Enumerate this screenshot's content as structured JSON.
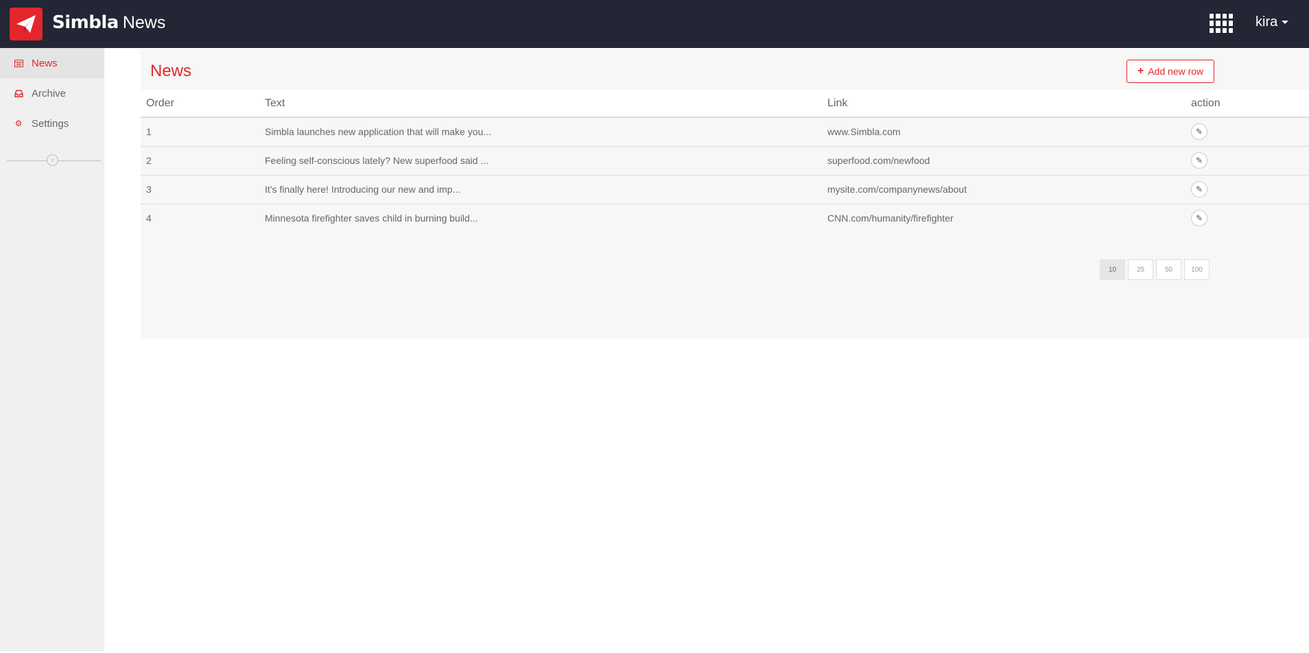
{
  "header": {
    "brand_logo": "Simbla",
    "app_name": "News",
    "apps_icon": "grid-apps-icon",
    "user_name": "kira"
  },
  "sidebar": {
    "items": [
      {
        "label": "News",
        "icon": "table-icon",
        "active": true
      },
      {
        "label": "Archive",
        "icon": "inbox-icon",
        "active": false
      },
      {
        "label": "Settings",
        "icon": "gear-icon",
        "active": false
      }
    ]
  },
  "main": {
    "title": "News",
    "add_button_label": "Add new row",
    "table": {
      "columns": [
        "Order",
        "Text",
        "Link",
        "action"
      ],
      "rows": [
        {
          "order": "1",
          "text": "Simbla launches new application that will make you...",
          "link": "www.Simbla.com"
        },
        {
          "order": "2",
          "text": "Feeling self-conscious lately? New superfood said ...",
          "link": "superfood.com/newfood"
        },
        {
          "order": "3",
          "text": "It's finally here! Introducing our new and imp...",
          "link": "mysite.com/companynews/about"
        },
        {
          "order": "4",
          "text": "Minnesota firefighter saves child in burning build...",
          "link": "CNN.com/humanity/firefighter"
        }
      ]
    },
    "page_sizes": [
      "10",
      "25",
      "50",
      "100"
    ],
    "selected_page_size": "10"
  },
  "colors": {
    "accent": "#e3262b",
    "topbar": "#232634",
    "sidebar": "#f0f0f0"
  }
}
